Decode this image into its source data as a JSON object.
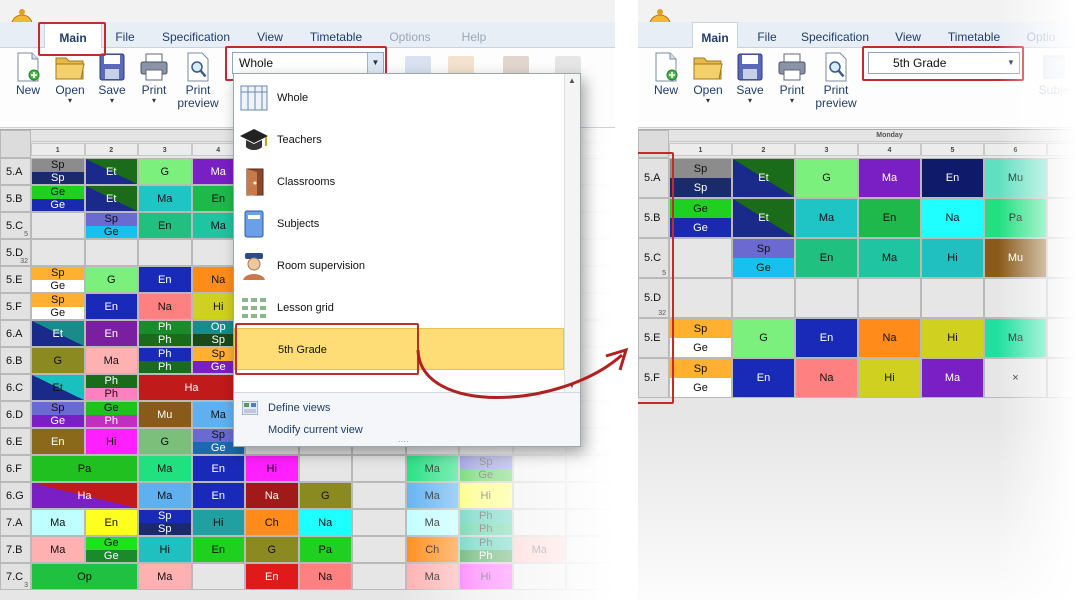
{
  "left": {
    "tabs": [
      {
        "label": "Main",
        "active": true
      },
      {
        "label": "File"
      },
      {
        "label": "Specification"
      },
      {
        "label": "View"
      },
      {
        "label": "Timetable"
      },
      {
        "label": "Options",
        "disabled": true
      },
      {
        "label": "Help",
        "disabled": true
      }
    ],
    "ribbon": [
      {
        "label": "New",
        "icon": "new-document-icon"
      },
      {
        "label": "Open",
        "icon": "open-folder-icon",
        "arrow": "▾"
      },
      {
        "label": "Save",
        "icon": "save-disk-icon",
        "arrow": "▾"
      },
      {
        "label": "Print",
        "icon": "printer-icon",
        "arrow": "▾"
      },
      {
        "label": "Print\npreview",
        "icon": "print-preview-icon"
      }
    ],
    "view_combo": "Whole",
    "day": "Monday",
    "periods": [
      "1",
      "2",
      "3",
      "4"
    ]
  },
  "dropdown": {
    "items": [
      {
        "label": "Whole",
        "icon": "grid-table-icon"
      },
      {
        "label": "Teachers",
        "icon": "graduation-cap-icon"
      },
      {
        "label": "Classrooms",
        "icon": "door-icon"
      },
      {
        "label": "Subjects",
        "icon": "book-icon"
      },
      {
        "label": "Room supervision",
        "icon": "supervisor-icon"
      },
      {
        "label": "Lesson grid",
        "icon": "lesson-grid-icon"
      },
      {
        "label": "5th Grade",
        "icon": "",
        "selected": true
      }
    ],
    "footer": [
      {
        "label": "Define views",
        "icon": "define-views-icon"
      },
      {
        "label": "Modify current view"
      }
    ]
  },
  "right": {
    "tabs": [
      {
        "label": "Main",
        "active": true
      },
      {
        "label": "File"
      },
      {
        "label": "Specification"
      },
      {
        "label": "View"
      },
      {
        "label": "Timetable"
      },
      {
        "label": "Optio",
        "disabled": true
      }
    ],
    "ribbon": [
      {
        "label": "New",
        "icon": "new-document-icon"
      },
      {
        "label": "Open",
        "icon": "open-folder-icon",
        "arrow": "▾"
      },
      {
        "label": "Save",
        "icon": "save-disk-icon",
        "arrow": "▾"
      },
      {
        "label": "Print",
        "icon": "printer-icon",
        "arrow": "▾"
      },
      {
        "label": "Print\npreview",
        "icon": "print-preview-icon"
      },
      {
        "label": "Subje",
        "icon": "subjects-icon",
        "disabled": true
      }
    ],
    "view_combo": "5th Grade",
    "day": "Monday",
    "periods": [
      "1",
      "2",
      "3",
      "4",
      "5",
      "6"
    ]
  },
  "timetable_left": [
    {
      "cls": "5.A",
      "cells": [
        {
          "t": "Sp",
          "b": "Sp",
          "tc": "#8c8c8c",
          "bc": "#1a2a6a"
        },
        {
          "f": "Et",
          "c": "#1a6b1a",
          "d": "#1a2a8a"
        },
        {
          "f": "G",
          "c": "#7cf07c"
        },
        {
          "f": "Ma",
          "c": "#7a1fc4"
        }
      ]
    },
    {
      "cls": "5.B",
      "cells": [
        {
          "t": "Ge",
          "b": "Ge",
          "tc": "#20d020",
          "bc": "#1a2ab0"
        },
        {
          "f": "Et",
          "c": "#1a6b1a",
          "d": "#1a2a8a"
        },
        {
          "f": "Ma",
          "c": "#1fc4c4"
        },
        {
          "f": "En",
          "c": "#1fb84a"
        }
      ]
    },
    {
      "cls": "5.C",
      "sub": "5",
      "cells": [
        {},
        {
          "t": "Sp",
          "b": "Ge",
          "tc": "#6a6ad0",
          "bc": "#18c0f0"
        },
        {
          "f": "En",
          "c": "#20c080"
        },
        {
          "f": "Ma",
          "c": "#1fc4a0"
        }
      ]
    },
    {
      "cls": "5.D",
      "sub": "32",
      "cells": [
        {},
        {},
        {},
        {}
      ]
    },
    {
      "cls": "5.E",
      "cells": [
        {
          "t": "Sp",
          "b": "Ge",
          "tc": "#ffb030",
          "bc": "#ffffff"
        },
        {
          "f": "G",
          "c": "#7cf07c"
        },
        {
          "f": "En",
          "c": "#1a2ab8"
        },
        {
          "f": "Na",
          "c": "#ff8c1a"
        }
      ]
    },
    {
      "cls": "5.F",
      "cells": [
        {
          "t": "Sp",
          "b": "Ge",
          "tc": "#ffb030",
          "bc": "#ffffff"
        },
        {
          "f": "En",
          "c": "#1a2ab8"
        },
        {
          "f": "Na",
          "c": "#ff8080"
        },
        {
          "f": "Hi",
          "c": "#d0d020"
        }
      ]
    },
    {
      "cls": "6.A",
      "cells": [
        {
          "f": "Et",
          "c": "#1a8a8a",
          "d": "#1a2a8a"
        },
        {
          "f": "En",
          "c": "#7a1fa0"
        },
        {
          "t": "Ph",
          "b": "Ph",
          "tc": "#1a8a2a",
          "bc": "#1a6b1a"
        },
        {
          "t": "Op",
          "b": "Sp",
          "tc": "#1a8a8a",
          "bc": "#1a4a1a"
        }
      ]
    },
    {
      "cls": "6.B",
      "cells": [
        {
          "f": "G",
          "c": "#8a8a20"
        },
        {
          "f": "Ma",
          "c": "#ffb0b0"
        },
        {
          "t": "Ph",
          "b": "Ph",
          "tc": "#1a2ab8",
          "bc": "#1a6b1a"
        },
        {
          "t": "Sp",
          "b": "Ge",
          "tc": "#ffb030",
          "bc": "#7a1fc4"
        }
      ]
    },
    {
      "cls": "6.C",
      "cells": [
        {
          "f": "Et",
          "c": "#1ac0c0",
          "d": "#1a2a8a"
        },
        {
          "t": "Ph",
          "b": "Ph",
          "tc": "#1a6b1a",
          "bc": "#ff80c0"
        },
        {
          "f": "Ha",
          "c": "#c01a1a",
          "span": 2
        }
      ]
    },
    {
      "cls": "6.D",
      "cells": [
        {
          "t": "Sp",
          "b": "Ge",
          "tc": "#6a6ad0",
          "bc": "#7a1fc4"
        },
        {
          "t": "Ge",
          "b": "Ph",
          "tc": "#20c020",
          "bc": "#c030c0"
        },
        {
          "f": "Mu",
          "c": "#8a5a1a"
        },
        {
          "f": "Ma",
          "c": "#60b0f0"
        }
      ]
    },
    {
      "cls": "6.E",
      "cells": [
        {
          "f": "En",
          "c": "#8a6a1a"
        },
        {
          "f": "Hi",
          "c": "#ff20ff"
        },
        {
          "f": "G",
          "c": "#7ac07a"
        },
        {
          "t": "Sp",
          "b": "Ge",
          "tc": "#6a6ad0",
          "bc": "#1a6ab0"
        }
      ]
    },
    {
      "cls": "6.F",
      "cells": [
        {
          "f": "Pa",
          "c": "#20c020",
          "span": 2
        },
        {
          "f": "Ma",
          "c": "#20e080"
        },
        {
          "f": "En",
          "c": "#1a2ab8"
        },
        {
          "f": "Hi",
          "c": "#ff20ff"
        },
        {},
        {},
        {
          "f": "Ma",
          "c": "#20e080"
        },
        {
          "t": "Sp",
          "b": "Ge",
          "tc": "#6a6ad0",
          "bc": "#20c020"
        },
        {}
      ]
    },
    {
      "cls": "6.G",
      "cells": [
        {
          "f": "Ha",
          "c": "#c01a1a",
          "d": "#7a1fc4",
          "span": 2
        },
        {
          "f": "Ma",
          "c": "#60b0f0"
        },
        {
          "f": "En",
          "c": "#1a2ab8"
        },
        {
          "f": "Na",
          "c": "#a01a1a"
        },
        {
          "f": "G",
          "c": "#8a8a20"
        },
        {},
        {
          "f": "Ma",
          "c": "#60b0f0"
        },
        {
          "f": "Hi",
          "c": "#ffff40"
        },
        {}
      ]
    },
    {
      "cls": "7.A",
      "cells": [
        {
          "f": "Ma",
          "c": "#c0ffff"
        },
        {
          "f": "En",
          "c": "#ffff20"
        },
        {
          "t": "Sp",
          "b": "Sp",
          "tc": "#1a2ab8",
          "bc": "#1a2a6a"
        },
        {
          "f": "Hi",
          "c": "#20a0a0"
        },
        {
          "f": "Ch",
          "c": "#ff8c1a"
        },
        {
          "f": "Na",
          "c": "#20ffff"
        },
        {},
        {
          "f": "Ma",
          "c": "#c0ffff"
        },
        {
          "t": "Ph",
          "b": "Ph",
          "tc": "#20c0a0",
          "bc": "#20c080"
        },
        {}
      ]
    },
    {
      "cls": "7.B",
      "cells": [
        {
          "f": "Ma",
          "c": "#ffb0b0"
        },
        {
          "t": "Ge",
          "b": "Ge",
          "tc": "#20e020",
          "bc": "#1a8a2a"
        },
        {
          "f": "Hi",
          "c": "#20c0c0"
        },
        {
          "f": "En",
          "c": "#20d020"
        },
        {
          "f": "G",
          "c": "#8a8a20"
        },
        {
          "f": "Pa",
          "c": "#20d020"
        },
        {},
        {
          "f": "Ch",
          "c": "#ff8c1a"
        },
        {
          "t": "Ph",
          "b": "Ph",
          "tc": "#20c0a0",
          "bc": "#1a8a2a"
        },
        {
          "f": "Ma",
          "c": "#ffb0b0"
        }
      ]
    },
    {
      "cls": "7.C",
      "sub": "3",
      "cells": [
        {
          "f": "Op",
          "c": "#20c040",
          "span": 2
        },
        {
          "f": "Ma",
          "c": "#ffb0b0"
        },
        {},
        {
          "f": "En",
          "c": "#e01a1a"
        },
        {
          "f": "Na",
          "c": "#ff8080"
        },
        {},
        {
          "f": "Ma",
          "c": "#ffb0b0"
        },
        {
          "f": "Hi",
          "c": "#ff40ff"
        },
        {}
      ]
    }
  ],
  "timetable_right": [
    {
      "cls": "5.A",
      "cells": [
        {
          "t": "Sp",
          "b": "Sp",
          "tc": "#8c8c8c",
          "bc": "#1a2a6a"
        },
        {
          "f": "Et",
          "c": "#1a6b1a",
          "d": "#1a2a8a"
        },
        {
          "f": "G",
          "c": "#7cf07c"
        },
        {
          "f": "Ma",
          "c": "#7a1fc4"
        },
        {
          "f": "En",
          "c": "#101a6a"
        },
        {
          "f": "Mu",
          "c": "#60e0c0"
        }
      ]
    },
    {
      "cls": "5.B",
      "cells": [
        {
          "t": "Ge",
          "b": "Ge",
          "tc": "#20d020",
          "bc": "#1a2ab0"
        },
        {
          "f": "Et",
          "c": "#1a6b1a",
          "d": "#1a2a8a"
        },
        {
          "f": "Ma",
          "c": "#1fc4c4"
        },
        {
          "f": "En",
          "c": "#1fb84a"
        },
        {
          "f": "Na",
          "c": "#20ffff"
        },
        {
          "f": "Pa",
          "c": "#20e080"
        }
      ]
    },
    {
      "cls": "5.C",
      "sub": "5",
      "cells": [
        {},
        {
          "t": "Sp",
          "b": "Ge",
          "tc": "#6a6ad0",
          "bc": "#18c0f0"
        },
        {
          "f": "En",
          "c": "#20c080"
        },
        {
          "f": "Ma",
          "c": "#1fc4a0"
        },
        {
          "f": "Hi",
          "c": "#20c0c0"
        },
        {
          "f": "Mu",
          "c": "#8a5a1a"
        }
      ]
    },
    {
      "cls": "5.D",
      "sub": "32",
      "cells": [
        {},
        {},
        {},
        {},
        {},
        {}
      ]
    },
    {
      "cls": "5.E",
      "cells": [
        {
          "t": "Sp",
          "b": "Ge",
          "tc": "#ffb030",
          "bc": "#ffffff"
        },
        {
          "f": "G",
          "c": "#7cf07c"
        },
        {
          "f": "En",
          "c": "#1a2ab8"
        },
        {
          "f": "Na",
          "c": "#ff8c1a"
        },
        {
          "f": "Hi",
          "c": "#d0d020"
        },
        {
          "f": "Ma",
          "c": "#20e0a0"
        }
      ]
    },
    {
      "cls": "5.F",
      "cells": [
        {
          "t": "Sp",
          "b": "Ge",
          "tc": "#ffb030",
          "bc": "#ffffff"
        },
        {
          "f": "En",
          "c": "#1a2ab8"
        },
        {
          "f": "Na",
          "c": "#ff8080"
        },
        {
          "f": "Hi",
          "c": "#d0d020"
        },
        {
          "f": "Ma",
          "c": "#7a1fc4"
        },
        {
          "f": "×",
          "c": "#e6e6e6"
        }
      ]
    }
  ]
}
